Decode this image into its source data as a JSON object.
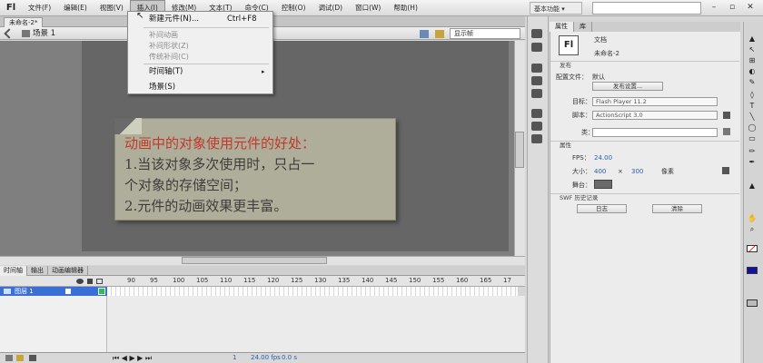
{
  "app": {
    "logo": "Fl"
  },
  "menubar": {
    "items": [
      "文件(F)",
      "编辑(E)",
      "视图(V)",
      "插入(I)",
      "修改(M)",
      "文本(T)",
      "命令(C)",
      "控制(O)",
      "调试(D)",
      "窗口(W)",
      "帮助(H)"
    ],
    "active_index": 3,
    "workspace": "基本功能 ▾"
  },
  "insert_menu": {
    "new_symbol": "新建元件(N)...",
    "new_symbol_shortcut": "Ctrl+F8",
    "motion_tween": "补间动画",
    "shape_tween": "补间形状(Z)",
    "classic_tween": "传统补间(C)",
    "timeline": "时间轴(T)",
    "scene": "场景(S)"
  },
  "document": {
    "tab": "未命名-2*",
    "scene": "场景 1",
    "zoom": "显示帧"
  },
  "stage_note": {
    "line1": "动画中的对象使用元件的好处：",
    "line2": "1.当该对象多次使用时，只占一",
    "line3": "个对象的存储空间；",
    "line4": "2.元件的动画效果更丰富。"
  },
  "timeline": {
    "tabs": [
      "时间轴",
      "输出",
      "动画编辑器"
    ],
    "ruler": [
      "90",
      "95",
      "100",
      "105",
      "110",
      "115",
      "120",
      "125",
      "130",
      "135",
      "140",
      "145",
      "150",
      "155",
      "160",
      "165",
      "17"
    ],
    "layer_name": "图层 1",
    "current_frame": "1",
    "fps": "24.00 fps",
    "time": "0.0 s"
  },
  "properties": {
    "tabs": [
      "属性",
      "库"
    ],
    "doc_icon": "Fl",
    "doc_type": "文档",
    "doc_name": "未命名-2",
    "publish_section": "发布",
    "profile_label": "配置文件：",
    "profile_value": "默认",
    "publish_settings": "发布设置...",
    "target_label": "目标：",
    "target_value": "Flash Player 11.2",
    "script_label": "脚本：",
    "script_value": "ActionScript 3.0",
    "class_label": "类：",
    "props_section": "属性",
    "fps_label": "FPS：",
    "fps_value": "24.00",
    "size_label": "大小：",
    "width": "400",
    "x": "×",
    "height": "300",
    "unit": "像素",
    "stage_label": "舞台：",
    "stage_color": "#6b6b6b",
    "swf_section": "SWF 历史记录",
    "log_button": "日志",
    "clear_button": "清除"
  },
  "tools": [
    "▲",
    "↖",
    "⊞",
    "◐",
    "✎",
    "◊",
    "T",
    "╲",
    "◯",
    "▭",
    "✏",
    "✒",
    "▲",
    "✋",
    "⌕"
  ]
}
